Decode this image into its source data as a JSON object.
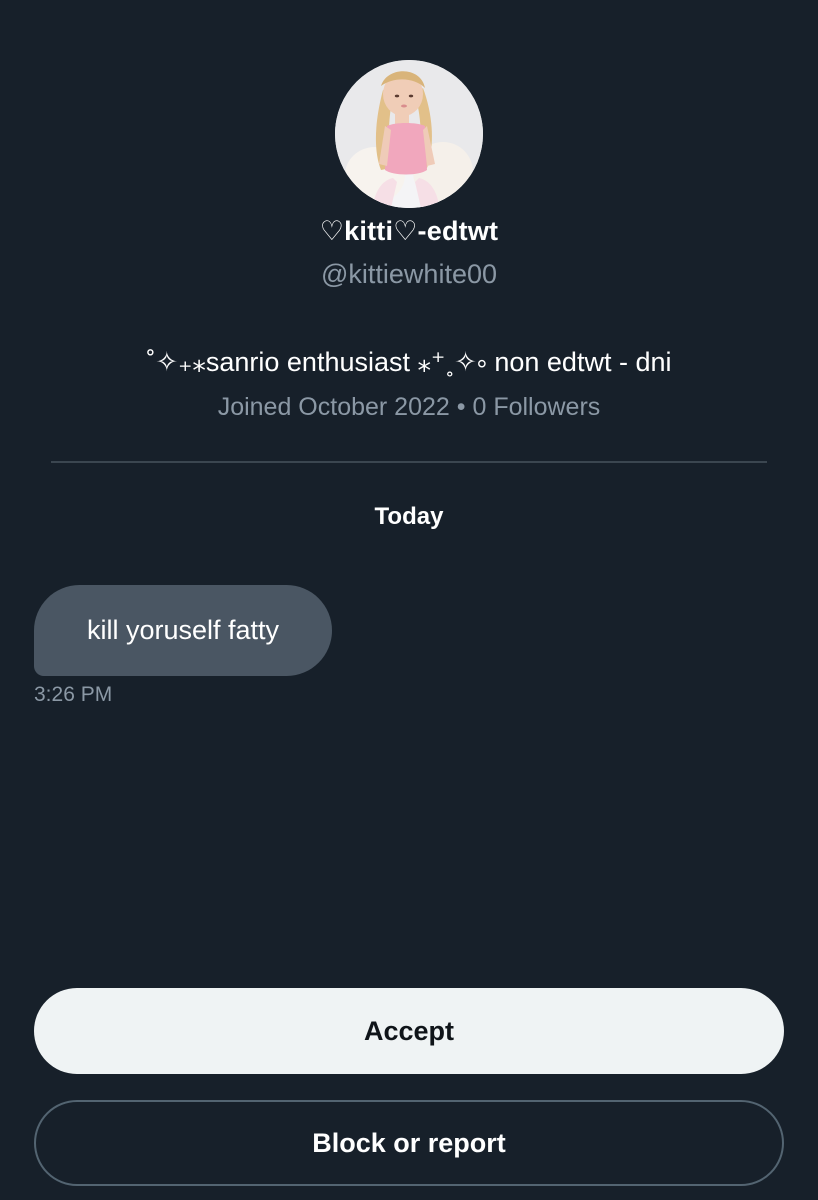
{
  "profile": {
    "display_name": "♡kitti♡-edtwt",
    "handle": "@kittiewhite00",
    "bio": "˚✧₊⁎sanrio enthusiast ⁎⁺˳✧༚ non edtwt - dni",
    "joined": "Joined October 2022",
    "separator": "•",
    "followers": "0 Followers"
  },
  "conversation": {
    "date_label": "Today",
    "messages": [
      {
        "text": "kill yoruself fatty",
        "time": "3:26 PM"
      }
    ]
  },
  "actions": {
    "accept_label": "Accept",
    "block_label": "Block or report"
  },
  "colors": {
    "background": "#17202a",
    "bubble": "#4a5663",
    "secondary_text": "#8b98a5",
    "accept_bg": "#eff3f4",
    "outline": "#536471"
  }
}
